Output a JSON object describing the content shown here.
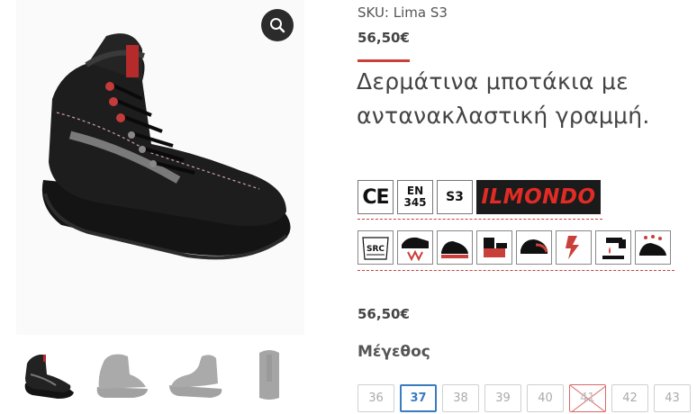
{
  "product": {
    "sku": "SKU: Lima S3",
    "price_top": "56,50€",
    "title": "Δερμάτινα μποτάκια με αντανακλαστική γραμμή.",
    "price_mid": "56,50€",
    "size_label": "Μέγεθος"
  },
  "certifications": {
    "ce": "CE",
    "en_line1": "EN",
    "en_line2": "345",
    "s3": "S3",
    "brand": "ILMONDO"
  },
  "pictograms": [
    {
      "icon": "src-slip-icon",
      "label": "SRC"
    },
    {
      "icon": "puncture-resistant-sole-icon"
    },
    {
      "icon": "antistatic-shoe-icon"
    },
    {
      "icon": "energy-absorbing-heel-icon"
    },
    {
      "icon": "toe-cap-protection-icon"
    },
    {
      "icon": "electrical-hazard-icon"
    },
    {
      "icon": "water-resistant-icon"
    },
    {
      "icon": "oil-resistant-sole-icon"
    }
  ],
  "sizes": [
    {
      "label": "36",
      "state": "available"
    },
    {
      "label": "37",
      "state": "selected"
    },
    {
      "label": "38",
      "state": "available"
    },
    {
      "label": "39",
      "state": "available"
    },
    {
      "label": "40",
      "state": "available"
    },
    {
      "label": "41",
      "state": "unavailable"
    },
    {
      "label": "42",
      "state": "available"
    },
    {
      "label": "43",
      "state": "available"
    }
  ],
  "colors": {
    "accent": "#c9403b",
    "selected": "#3b7bbf",
    "brand_red": "#e22b25"
  }
}
